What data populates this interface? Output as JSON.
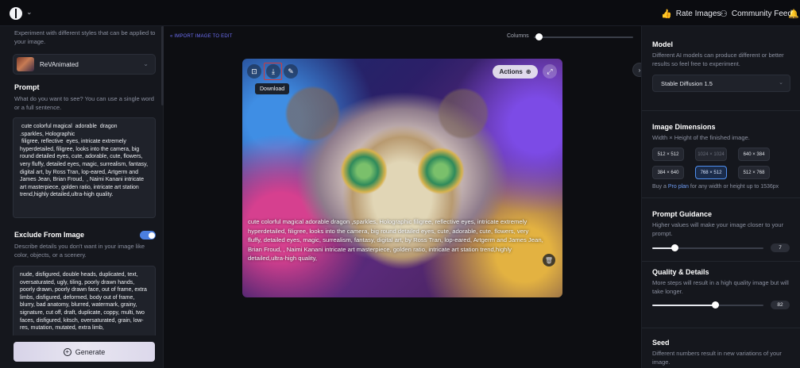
{
  "topbar": {
    "rate_images": "Rate Images",
    "community_feed": "Community Feed",
    "rate_icon": "thumbs-up-icon",
    "community_icon": "people-icon",
    "bell_icon": "bell-icon"
  },
  "left": {
    "intro": "Experiment with different styles that can be applied to your image.",
    "model_name": "ReVAnimated",
    "prompt_title": "Prompt",
    "prompt_desc": "What do you want to see? You can use a single word or a full sentence.",
    "prompt_text": " cute colorful magical  adorable  dragon\n.sparkles, Holographic\n filigree, reflective  eyes, intricate extremely hyperdetailed, filigree, looks into the camera, big round detailed eyes, cute, adorable, cute, flowers, very fluffy, detailed eyes, magic, surrealism, fantasy, digital art, by Ross Tran, lop-eared, Artgerm and James Jean, Brian Froud,  , Naimi Kanani intricate art masterpiece, golden ratio, intricate art station trend,highly detailed,ultra-high quality.",
    "exclude_title": "Exclude From Image",
    "exclude_desc": "Describe details you don't want in your image like color, objects, or a scenery.",
    "exclude_enabled": true,
    "exclude_text": "nude, disfigured, double heads, duplicated, text, oversaturated, ugly, tiling, poorly drawn hands, poorly drawn, poorly drawn face, out of frame, extra limbs, disfigured, deformed, body out of frame, blurry, bad anatomy, blurred, watermark, grainy, signature, cut off, draft, duplicate, coppy, multi, two faces, disfigured, kitsch, oversaturated, grain, low-res, mutation, mutated, extra limb,",
    "generate_label": "Generate"
  },
  "main": {
    "import_link": "« IMPORT IMAGE TO EDIT",
    "columns_label": "Columns",
    "columns_value": 0.05,
    "download_tooltip": "Download",
    "actions_label": "Actions",
    "caption": "cute colorful magical adorable dragon ,sparkles, Holographic filigree, reflective eyes, intricate extremely hyperdetailed, filigree, looks into the camera, big round detailed eyes, cute, adorable, cute, flowers, very fluffy, detailed eyes, magic, surrealism, fantasy, digital art, by Ross Tran, lop-eared, Artgerm and James Jean, Brian Froud, , Naimi Kanani intricate art masterpiece, golden ratio, intricate art station trend,highly detailed,ultra-high quality,"
  },
  "right": {
    "model_title": "Model",
    "model_desc": "Different AI models can produce different or better results so feel free to experiment.",
    "model_value": "Stable Diffusion 1.5",
    "dim_title": "Image Dimensions",
    "dim_desc": "Width × Height of the finished image.",
    "dimensions": [
      {
        "label": "512 × 512",
        "state": "normal"
      },
      {
        "label": "1024 × 1024",
        "state": "disabled"
      },
      {
        "label": "640 × 384",
        "state": "normal"
      },
      {
        "label": "384 × 640",
        "state": "normal"
      },
      {
        "label": "768 × 512",
        "state": "active"
      },
      {
        "label": "512 × 768",
        "state": "normal"
      }
    ],
    "pro_prefix": "Buy a ",
    "pro_link": "Pro plan",
    "pro_suffix": " for any width or height up to 1536px",
    "guidance_title": "Prompt Guidance",
    "guidance_desc": "Higher values will make your image closer to your prompt.",
    "guidance_value": "7",
    "guidance_fraction": 0.2,
    "quality_title": "Quality & Details",
    "quality_desc": "More steps will result in a high quality image but will take longer.",
    "quality_value": "82",
    "quality_fraction": 0.57,
    "seed_title": "Seed",
    "seed_desc": "Different numbers result in new variations of your image."
  },
  "colors": {
    "accent": "#4f8ff0",
    "link": "#6d6ff5",
    "download_highlight": "#d23b3b"
  }
}
